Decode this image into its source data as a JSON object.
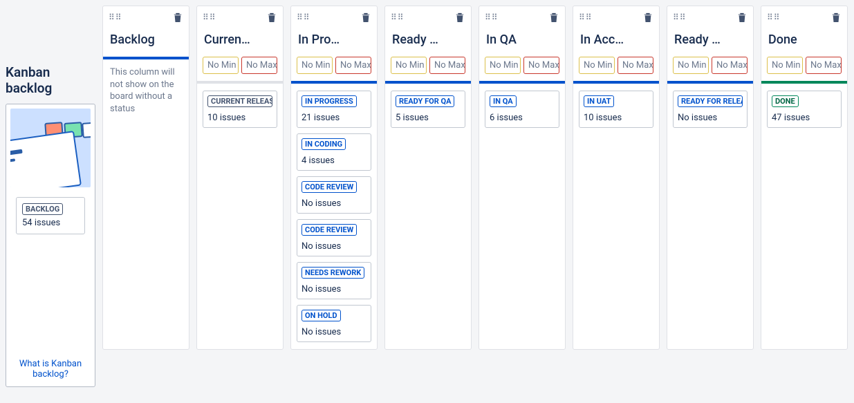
{
  "sidebar": {
    "title": "Kanban backlog",
    "status": {
      "label": "BACKLOG",
      "count": "54 issues"
    },
    "help": "What is Kanban backlog?"
  },
  "limit_min_label": "No Min",
  "limit_max_label": "No Max",
  "columns": [
    {
      "title": "Backlog",
      "has_limits": false,
      "divider": "blue",
      "note": "This column will not show on the board without a status",
      "cards": []
    },
    {
      "title": "Curren…",
      "has_limits": true,
      "divider": "grey",
      "cards": [
        {
          "label": "CURRENT RELEASE",
          "style": "default",
          "count": "10 issues"
        }
      ]
    },
    {
      "title": "In Pro…",
      "has_limits": true,
      "divider": "blue",
      "cards": [
        {
          "label": "IN PROGRESS",
          "style": "blue",
          "count": "21 issues"
        },
        {
          "label": "IN CODING",
          "style": "blue",
          "count": "4 issues"
        },
        {
          "label": "CODE REVIEW",
          "style": "blue",
          "count": "No issues"
        },
        {
          "label": "CODE REVIEW",
          "style": "blue",
          "count": "No issues"
        },
        {
          "label": "NEEDS REWORK",
          "style": "blue",
          "count": "No issues"
        },
        {
          "label": "ON HOLD",
          "style": "blue",
          "count": "No issues"
        }
      ]
    },
    {
      "title": "Ready …",
      "has_limits": true,
      "divider": "blue",
      "cards": [
        {
          "label": "READY FOR QA",
          "style": "blue",
          "count": "5 issues"
        }
      ]
    },
    {
      "title": "In QA",
      "has_limits": true,
      "divider": "blue",
      "cards": [
        {
          "label": "IN QA",
          "style": "blue",
          "count": "6 issues"
        }
      ]
    },
    {
      "title": "In Acc…",
      "has_limits": true,
      "divider": "blue",
      "cards": [
        {
          "label": "IN UAT",
          "style": "blue",
          "count": "10 issues"
        }
      ]
    },
    {
      "title": "Ready …",
      "has_limits": true,
      "divider": "blue",
      "cards": [
        {
          "label": "READY FOR RELEASE",
          "style": "blue",
          "count": "No issues"
        }
      ]
    },
    {
      "title": "Done",
      "has_limits": true,
      "divider": "green",
      "cards": [
        {
          "label": "DONE",
          "style": "green",
          "count": "47 issues"
        }
      ]
    }
  ]
}
